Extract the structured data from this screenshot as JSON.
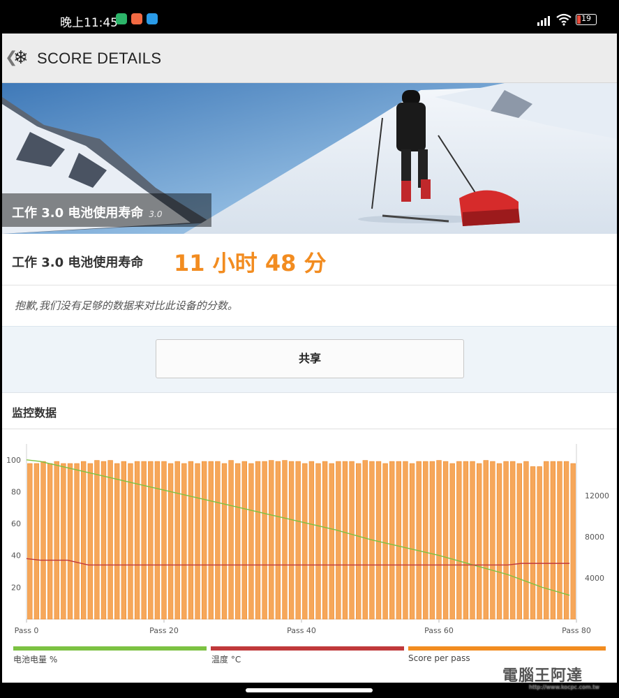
{
  "status_bar": {
    "time": "晚上11:45",
    "battery": "19",
    "icons": [
      "signal-icon",
      "wifi-icon",
      "battery-icon"
    ]
  },
  "app_bar": {
    "title": "SCORE DETAILS",
    "back_icon": "chevron-left-icon",
    "logo_icon": "snowflake-icon"
  },
  "hero": {
    "title": "工作 3.0 电池使用寿命",
    "version": "3.0"
  },
  "result": {
    "label": "工作 3.0 电池使用寿命",
    "value": "11 小时 48 分"
  },
  "note": "抱歉,我们没有足够的数据来对比此设备的分数。",
  "share_button": "共享",
  "monitoring": {
    "title": "监控数据"
  },
  "legend": {
    "battery": "电池电量 %",
    "temperature": "温度 °C",
    "score": "Score per pass"
  },
  "watermark": {
    "text": "電腦王阿達",
    "url": "http://www.kocpc.com.tw"
  },
  "colors": {
    "accent_orange": "#f28c20",
    "battery_green": "#7cc242",
    "temp_red": "#c0393b"
  },
  "chart_data": {
    "type": "bar",
    "xlabel": "",
    "ylabel": "",
    "x_ticks": [
      "Pass 0",
      "Pass 20",
      "Pass 40",
      "Pass 60",
      "Pass 80"
    ],
    "x_range": [
      0,
      80
    ],
    "y_left_ticks": [
      20,
      40,
      60,
      80,
      100
    ],
    "y_left_range": [
      0,
      110
    ],
    "y_right_ticks": [
      4000,
      8000,
      12000
    ],
    "y_right_range": [
      0,
      17000
    ],
    "grid": false,
    "series": [
      {
        "name": "Score per pass",
        "axis": "right",
        "kind": "bar",
        "values": [
          15100,
          15100,
          15300,
          15100,
          15300,
          15100,
          15100,
          15100,
          15300,
          15100,
          15400,
          15300,
          15400,
          15100,
          15300,
          15100,
          15300,
          15300,
          15300,
          15300,
          15300,
          15100,
          15300,
          15100,
          15300,
          15100,
          15300,
          15300,
          15300,
          15100,
          15400,
          15100,
          15300,
          15100,
          15300,
          15300,
          15400,
          15300,
          15400,
          15300,
          15300,
          15100,
          15300,
          15100,
          15300,
          15100,
          15300,
          15300,
          15300,
          15100,
          15400,
          15300,
          15300,
          15100,
          15300,
          15300,
          15300,
          15100,
          15300,
          15300,
          15300,
          15400,
          15300,
          15100,
          15300,
          15300,
          15300,
          15100,
          15400,
          15300,
          15100,
          15300,
          15300,
          15100,
          15300,
          14800,
          14800,
          15300,
          15300,
          15300,
          15300,
          15100
        ]
      },
      {
        "name": "电池电量 %",
        "axis": "left",
        "kind": "line",
        "x": [
          0,
          2,
          5,
          10,
          15,
          20,
          25,
          30,
          35,
          40,
          45,
          50,
          55,
          60,
          65,
          70,
          75,
          79
        ],
        "values": [
          100,
          99,
          96,
          91,
          86,
          81,
          76,
          71,
          66,
          61,
          56,
          50,
          45,
          40,
          34,
          28,
          20,
          15
        ]
      },
      {
        "name": "温度 °C",
        "axis": "left",
        "kind": "line",
        "x": [
          0,
          2,
          4,
          6,
          8,
          9,
          20,
          30,
          40,
          48,
          50,
          52,
          56,
          60,
          70,
          72,
          76,
          79
        ],
        "values": [
          38,
          37,
          37,
          37,
          35,
          34,
          34,
          34,
          34,
          34,
          34,
          34,
          34,
          34,
          34,
          35,
          35,
          35
        ]
      }
    ]
  }
}
